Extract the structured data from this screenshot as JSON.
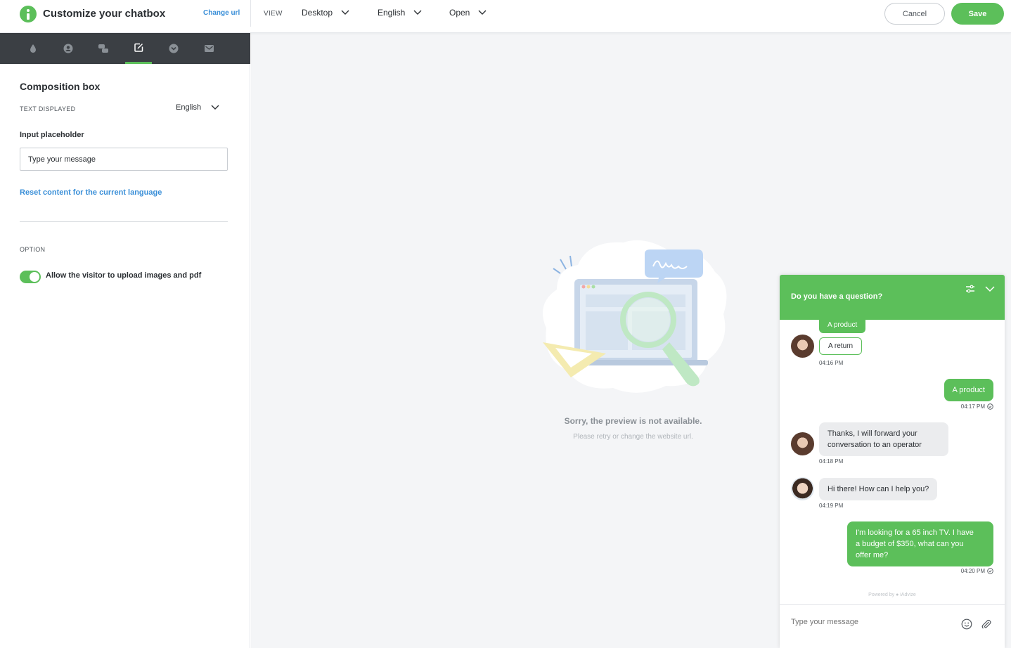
{
  "header": {
    "title": "Customize your chatbox",
    "change_url": "Change url",
    "view_label": "VIEW",
    "device": "Desktop",
    "language": "English",
    "state": "Open",
    "cancel": "Cancel",
    "save": "Save"
  },
  "sidebar": {
    "tabs": [
      {
        "icon": "droplet-icon"
      },
      {
        "icon": "user-icon"
      },
      {
        "icon": "chat-bubbles-icon"
      },
      {
        "icon": "edit-icon",
        "active": true
      },
      {
        "icon": "chevron-circle-icon"
      },
      {
        "icon": "mail-icon"
      }
    ],
    "section_title": "Composition box",
    "text_displayed_label": "TEXT DISPLAYED",
    "text_displayed_language": "English",
    "input_placeholder_label": "Input placeholder",
    "input_placeholder_value": "Type your message",
    "reset_link": "Reset content for the current language",
    "option_label": "OPTION",
    "upload_toggle_label": "Allow the visitor to upload images and pdf",
    "upload_toggle_on": true
  },
  "preview": {
    "sorry_text": "Sorry, the preview is not available.",
    "retry_text": "Please retry or change the website url."
  },
  "chatbox": {
    "question": "Do you have a question?",
    "chip_product": "A product",
    "chip_return": "A return",
    "ts1": "04:16 PM",
    "msg_visitor_product": "A product",
    "ts2": "04:17 PM",
    "msg_forward_1": "Thanks, I will forward your",
    "msg_forward_2": "conversation to an operator",
    "ts3": "04:18 PM",
    "msg_hi": "Hi there! How can I help you?",
    "ts4": "04:19 PM",
    "msg_tv_1": "I'm looking for a 65 inch TV. I have",
    "msg_tv_2": "a budget of $350, what can you",
    "msg_tv_3": "offer me?",
    "ts5": "04:20 PM",
    "powered": "Powered by ● iAdvize",
    "input_placeholder": "Type your message"
  },
  "colors": {
    "accent": "#5cbf5a",
    "link": "#3a8fd8",
    "tabbar": "#3b3f44",
    "preview_bg": "#f4f5f7"
  }
}
